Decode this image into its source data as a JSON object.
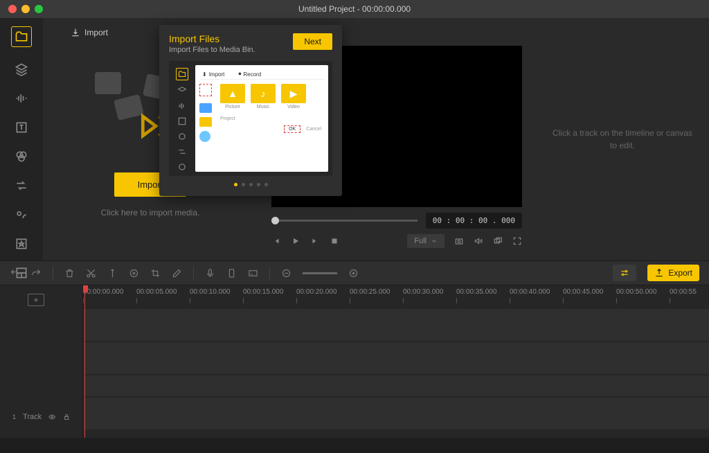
{
  "window": {
    "title": "Untitled Project - 00:00:00.000"
  },
  "sidebar": {
    "items": [
      {
        "name": "media",
        "active": true
      },
      {
        "name": "layers"
      },
      {
        "name": "audio"
      },
      {
        "name": "text"
      },
      {
        "name": "filters"
      },
      {
        "name": "transitions"
      },
      {
        "name": "elements"
      },
      {
        "name": "favorites"
      },
      {
        "name": "layout"
      }
    ]
  },
  "media": {
    "import_top": "Import",
    "import_button": "Import",
    "hint": "Click here to import media."
  },
  "preview": {
    "timecode": "00 : 00 : 00 . 000",
    "size_label": "Full"
  },
  "inspector": {
    "hint": "Click a track on the timeline or canvas to edit."
  },
  "toolbar": {
    "export": "Export"
  },
  "timeline": {
    "track_label": "Track",
    "ticks": [
      "00:00:00.000",
      "00:00:05.000",
      "00:00:10.000",
      "00:00:15.000",
      "00:00:20.000",
      "00:00:25.000",
      "00:00:30.000",
      "00:00:35.000",
      "00:00:40.000",
      "00:00:45.000",
      "00:00:50.000",
      "00:00:55"
    ]
  },
  "popup": {
    "title": "Import Files",
    "subtitle": "Import Files to Media Bin.",
    "next": "Next",
    "tabs": {
      "import": "Import",
      "record": "Record"
    },
    "thumbs": [
      {
        "label": "Picture"
      },
      {
        "label": "Music"
      },
      {
        "label": "Video"
      }
    ],
    "project": "Project",
    "ok": "OK",
    "cancel": "Cancel",
    "page": 1,
    "pages": 5
  }
}
